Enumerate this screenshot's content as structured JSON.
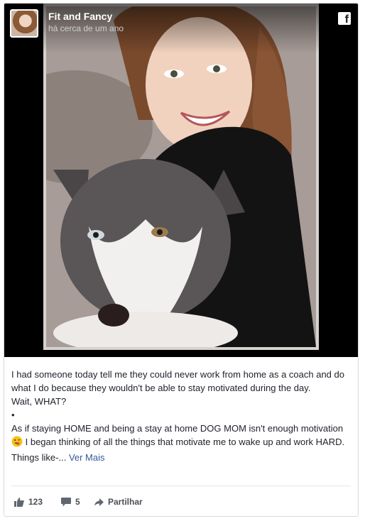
{
  "header": {
    "page_name": "Fit and Fancy",
    "timestamp": "há cerca de um ano",
    "logo_icon": "facebook-icon"
  },
  "post": {
    "lines": [
      "I had someone today tell me they could never work from home as a coach and do what I do because they wouldn't be able to stay motivated during the day.",
      "Wait, WHAT?",
      "•",
      "As if staying HOME and being a stay at home DOG MOM isn't enough motivation"
    ],
    "line_cont": " I began thinking of all the things that motivate me to wake up and work HARD. Things like-...",
    "see_more": "Ver Mais",
    "emoji_icon": "winking-tongue-emoji-icon"
  },
  "actions": {
    "likes": "123",
    "comments": "5",
    "share": "Partilhar"
  },
  "colors": {
    "link": "#365899",
    "text": "#1d2129",
    "meta": "#4b4f56"
  }
}
